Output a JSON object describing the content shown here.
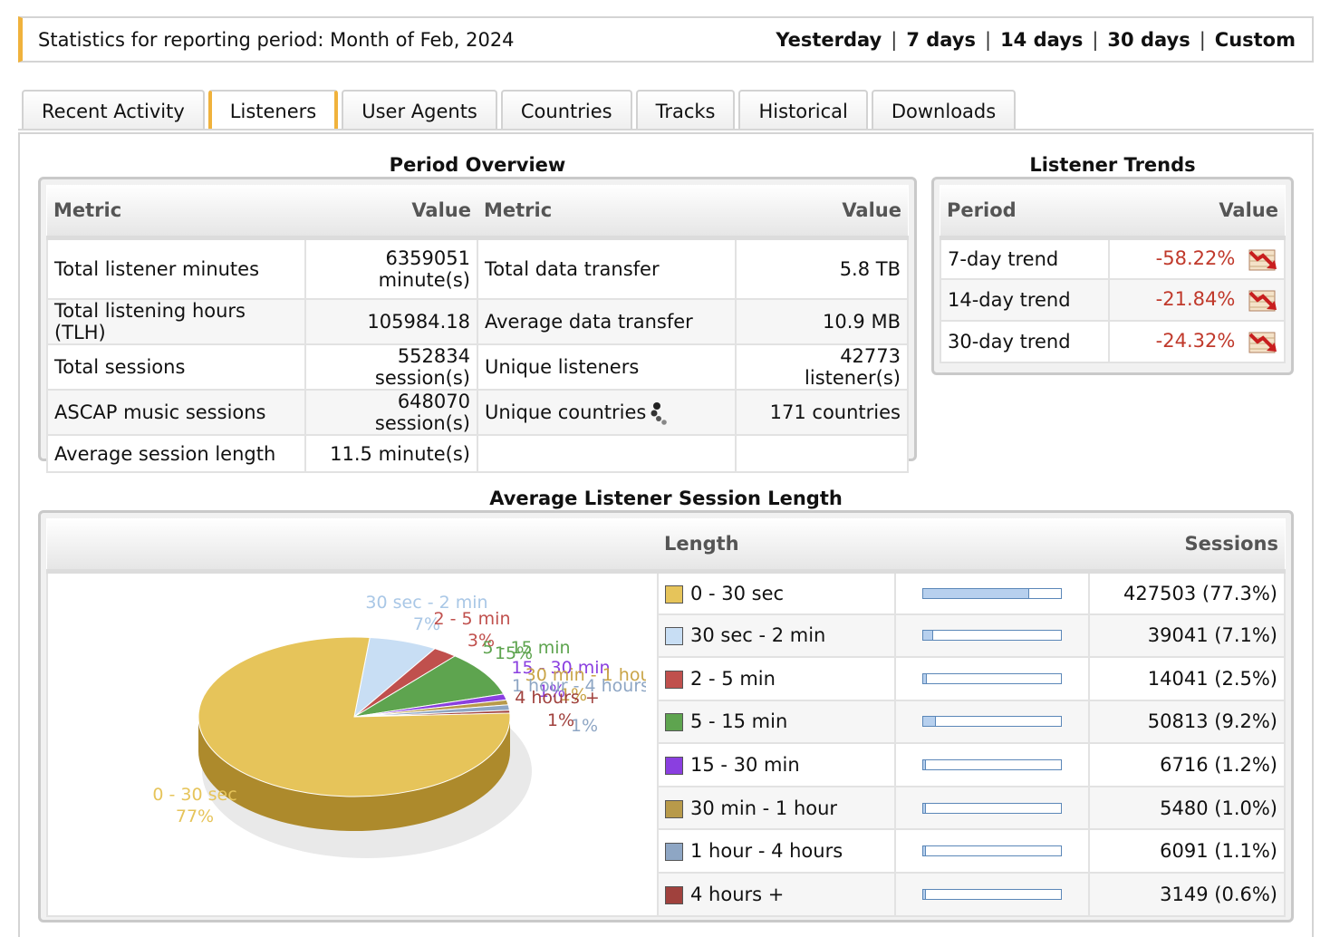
{
  "header": {
    "period_text": "Statistics for reporting period: Month of Feb, 2024",
    "links": [
      "Yesterday",
      "7 days",
      "14 days",
      "30 days",
      "Custom"
    ],
    "separator": "|"
  },
  "tabs": [
    {
      "label": "Recent Activity",
      "active": false
    },
    {
      "label": "Listeners",
      "active": true
    },
    {
      "label": "User Agents",
      "active": false
    },
    {
      "label": "Countries",
      "active": false
    },
    {
      "label": "Tracks",
      "active": false
    },
    {
      "label": "Historical",
      "active": false
    },
    {
      "label": "Downloads",
      "active": false
    }
  ],
  "overview": {
    "title": "Period Overview",
    "headers": [
      "Metric",
      "Value",
      "Metric",
      "Value"
    ],
    "rows": [
      [
        "Total listener minutes",
        "6359051 minute(s)",
        "Total data transfer",
        "5.8 TB"
      ],
      [
        "Total listening hours (TLH)",
        "105984.18",
        "Average data transfer",
        "10.9 MB"
      ],
      [
        "Total sessions",
        "552834 session(s)",
        "Unique listeners",
        "42773 listener(s)"
      ],
      [
        "ASCAP music sessions",
        "648070 session(s)",
        "Unique countries",
        "171 countries"
      ],
      [
        "Average session length",
        "11.5 minute(s)",
        "",
        ""
      ]
    ]
  },
  "trends": {
    "title": "Listener Trends",
    "headers": [
      "Period",
      "Value"
    ],
    "rows": [
      {
        "period": "7-day trend",
        "value": "-58.22%"
      },
      {
        "period": "14-day trend",
        "value": "-21.84%"
      },
      {
        "period": "30-day trend",
        "value": "-24.32%"
      }
    ],
    "icon": "trend-down-icon"
  },
  "session_length": {
    "title": "Average Listener Session Length",
    "headers": [
      "Length",
      "Sessions"
    ]
  },
  "chart_data": {
    "type": "pie",
    "categories": [
      "0 - 30 sec",
      "30 sec - 2 min",
      "2 - 5 min",
      "5 - 15 min",
      "15 - 30 min",
      "30 min - 1 hour",
      "1 hour - 4 hours",
      "4 hours +"
    ],
    "values": [
      427503,
      39041,
      14041,
      50813,
      6716,
      5480,
      6091,
      3149
    ],
    "display": [
      "427503 (77.3%)",
      "39041 (7.1%)",
      "14041 (2.5%)",
      "50813 (9.2%)",
      "6716 (1.2%)",
      "5480 (1.0%)",
      "6091 (1.1%)",
      "3149 (0.6%)"
    ],
    "fractions": [
      0.773,
      0.071,
      0.025,
      0.092,
      0.012,
      0.01,
      0.011,
      0.006
    ],
    "pie_labels": [
      "77%",
      "7%",
      "3%",
      "15%",
      "1%",
      "1%",
      "1%",
      "1%"
    ],
    "colors": [
      "#e6c45a",
      "#c8def4",
      "#c0504d",
      "#5ea44f",
      "#8a3fe0",
      "#b89a4a",
      "#8ea6c4",
      "#a0413d"
    ],
    "label_colors": [
      "#e6c45a",
      "#a9c7e6",
      "#c0504d",
      "#5ea44f",
      "#8a3fe0",
      "#c9a447",
      "#8ea6c4",
      "#a0413d"
    ]
  }
}
